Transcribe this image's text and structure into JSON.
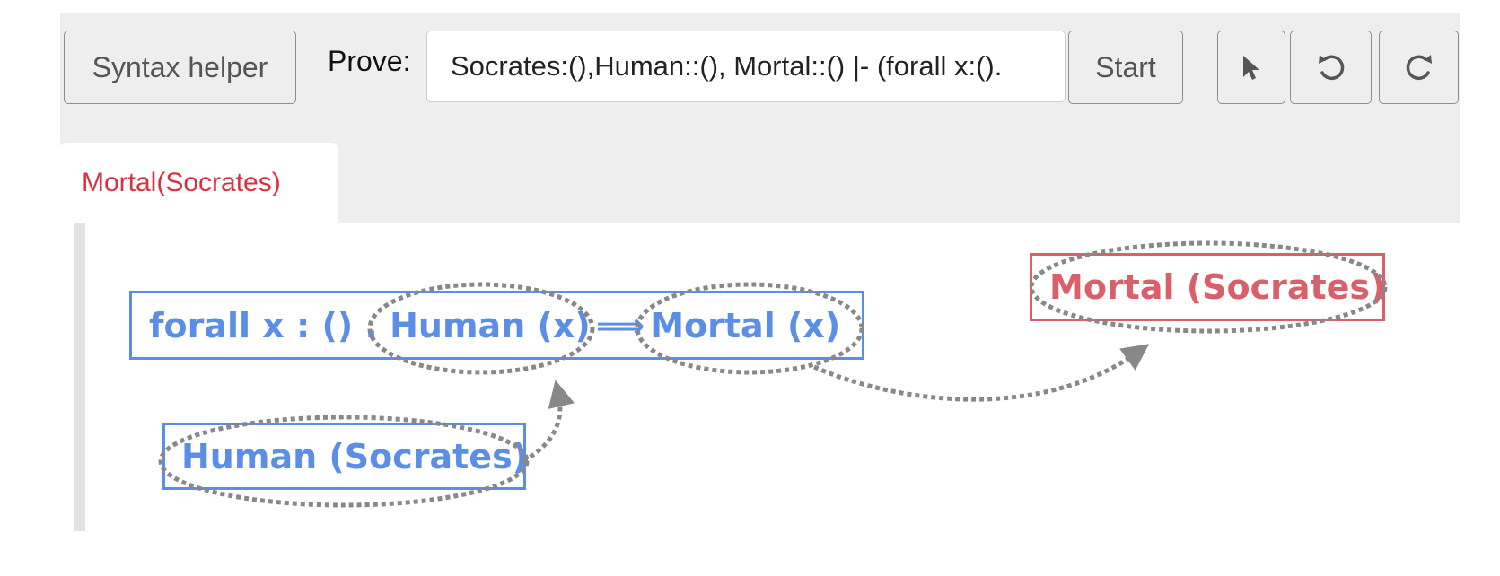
{
  "toolbar": {
    "syntax_helper_label": "Syntax helper",
    "prove_label": "Prove:",
    "prove_input_value": "Socrates:(),Human::(), Mortal::() |- (forall x:().",
    "start_label": "Start",
    "pointer_icon": "pointer-icon",
    "undo_icon": "undo-icon",
    "redo_icon": "redo-icon"
  },
  "tabs": [
    {
      "label": "Mortal(Socrates)",
      "color": "#d9323f"
    }
  ],
  "canvas": {
    "formulas": [
      {
        "id": "forall",
        "prefix": "forall x : () . ",
        "antecedent": "Human (x)",
        "arrow": "⟹",
        "consequent": "Mortal (x)",
        "color": "#5b8fe6"
      },
      {
        "id": "human-socrates",
        "text": "Human (Socrates)",
        "color": "#5b8fe6"
      },
      {
        "id": "goal",
        "text": "Mortal (Socrates)",
        "color": "#d95f6a"
      }
    ],
    "link_color": "#888888"
  }
}
